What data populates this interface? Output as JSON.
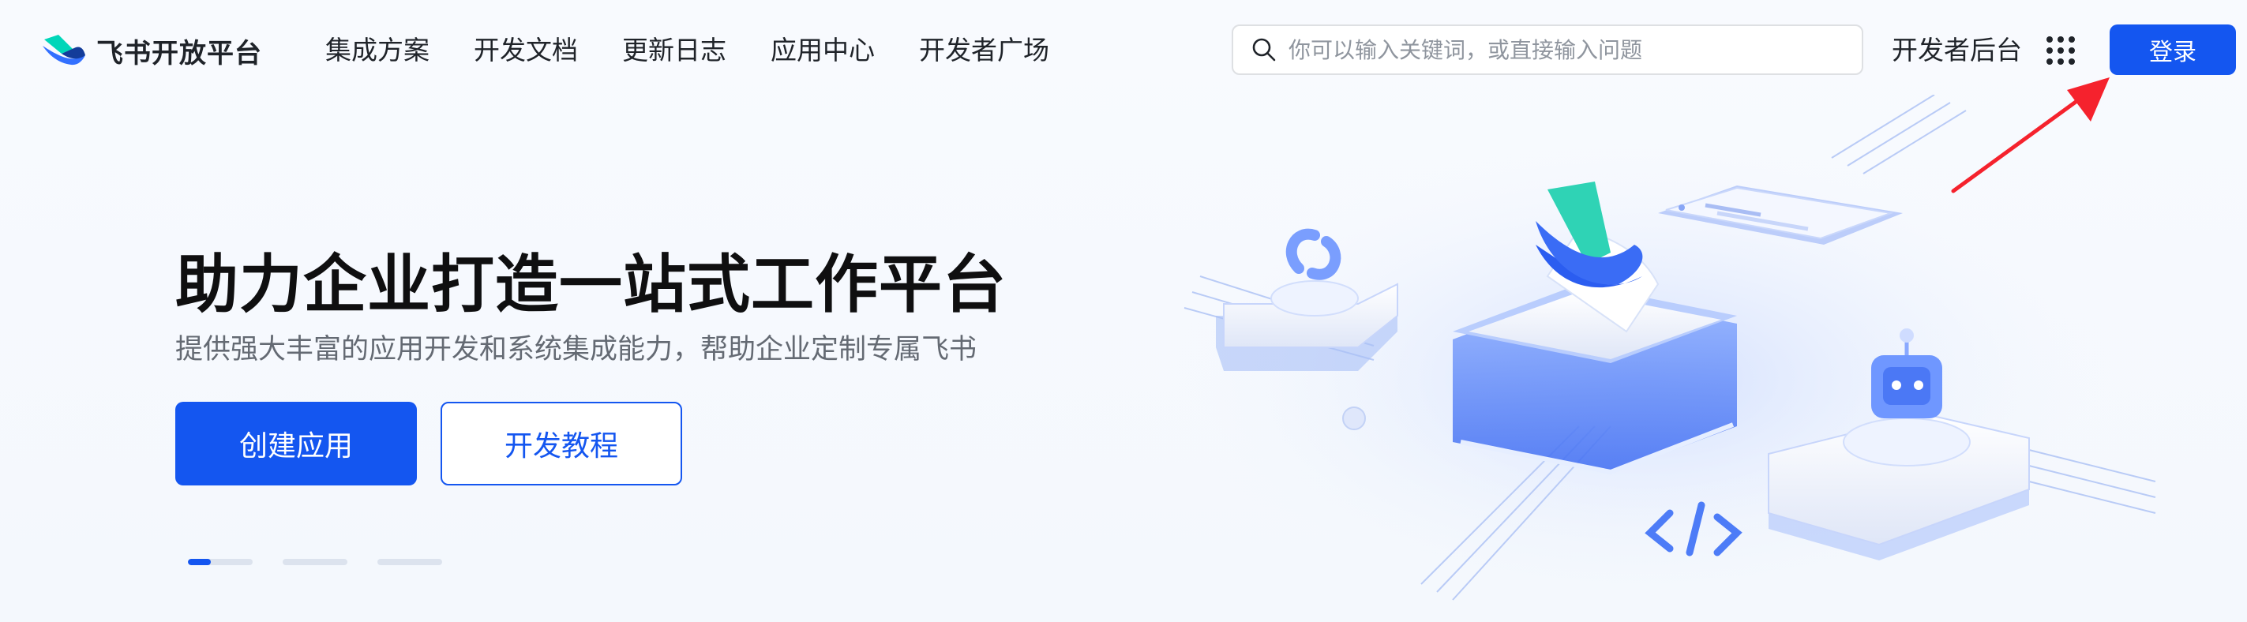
{
  "brand": {
    "name": "飞书开放平台",
    "logo_icon": "feishu-logo-icon"
  },
  "nav": {
    "items": [
      {
        "label": "集成方案"
      },
      {
        "label": "开发文档"
      },
      {
        "label": "更新日志"
      },
      {
        "label": "应用中心"
      },
      {
        "label": "开发者广场"
      }
    ]
  },
  "search": {
    "placeholder": "你可以输入关键词，或直接输入问题",
    "value": "",
    "icon": "search-icon"
  },
  "header_actions": {
    "dev_backend": "开发者后台",
    "apps_icon": "grid-apps-icon",
    "login": "登录"
  },
  "hero": {
    "title": "助力企业打造一站式工作平台",
    "subtitle": "提供强大丰富的应用开发和系统集成能力，帮助企业定制专属飞书",
    "primary_button": "创建应用",
    "secondary_button": "开发教程"
  },
  "carousel": {
    "slides": 3,
    "active_index": 0,
    "active_progress": 0.35
  },
  "colors": {
    "brand_blue": "#1456f0",
    "annotation_red": "#f5222d",
    "text_dark": "#1f2329",
    "text_gray": "#646a73"
  }
}
